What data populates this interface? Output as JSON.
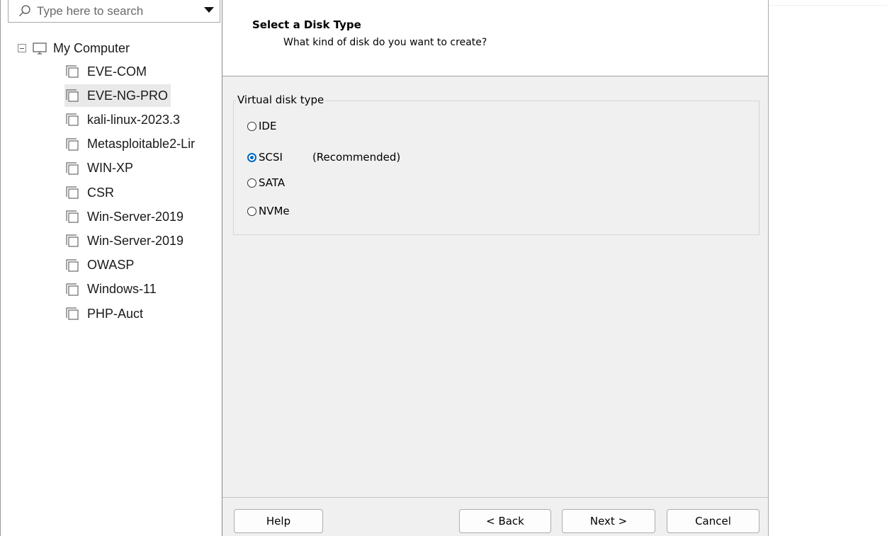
{
  "library": {
    "search": {
      "placeholder": "Type here to search"
    },
    "root": {
      "label": "My Computer"
    },
    "vms": [
      {
        "label": "EVE-COM"
      },
      {
        "label": "EVE-NG-PRO",
        "selected": true
      },
      {
        "label": "kali-linux-2023.3"
      },
      {
        "label": "Metasploitable2-Lir"
      },
      {
        "label": "WIN-XP"
      },
      {
        "label": "CSR"
      },
      {
        "label": "Win-Server-2019"
      },
      {
        "label": "Win-Server-2019"
      },
      {
        "label": "OWASP"
      },
      {
        "label": "Windows-11"
      },
      {
        "label": "PHP-Auct"
      }
    ]
  },
  "wizard": {
    "title": "Select a Disk Type",
    "subtitle": "What kind of disk do you want to create?",
    "group_label": "Virtual disk type",
    "options": [
      {
        "label": "IDE",
        "note": "",
        "checked": false
      },
      {
        "label": "SCSI",
        "note": "(Recommended)",
        "checked": true
      },
      {
        "label": "SATA",
        "note": "",
        "checked": false
      },
      {
        "label": "NVMe",
        "note": "",
        "checked": false
      }
    ],
    "buttons": {
      "help": "Help",
      "back": "< Back",
      "next": "Next >",
      "cancel": "Cancel"
    }
  },
  "colors": {
    "accent": "#0067c0",
    "dialog_bg": "#f0f0f0",
    "selected_row": "#e9e9e9"
  }
}
